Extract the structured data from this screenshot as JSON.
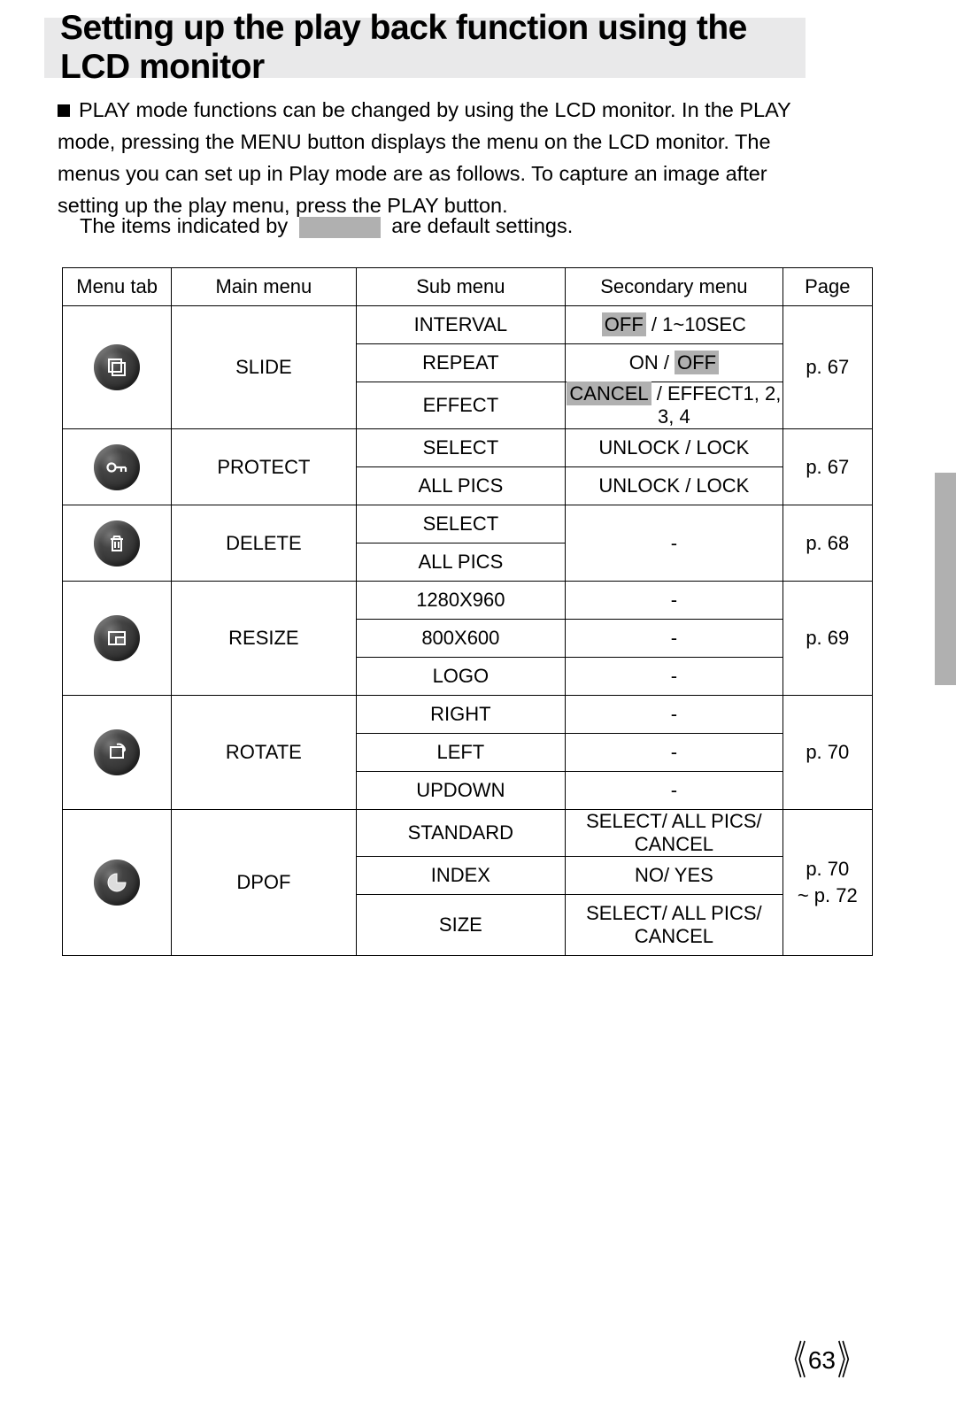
{
  "title": "Setting up the play back function using the LCD monitor",
  "intro": "PLAY mode functions can be changed by using the LCD monitor. In the PLAY mode, pressing the MENU button displays the menu on the LCD monitor. The menus you can set up in Play mode are as follows. To capture an image after setting up the play menu, press the PLAY button.",
  "default_note_pre": "The items indicated by",
  "default_note_post": "are default settings.",
  "headers": {
    "tab": "Menu tab",
    "main": "Main menu",
    "sub": "Sub menu",
    "sec": "Secondary menu",
    "page": "Page"
  },
  "rows": {
    "slide": {
      "main": "SLIDE",
      "page": "p. 67",
      "sub": [
        "INTERVAL",
        "REPEAT",
        "EFFECT"
      ],
      "sec_interval_hl": "OFF",
      "sec_interval_rest": " / 1~10SEC",
      "sec_repeat_pre": "ON / ",
      "sec_repeat_hl": "OFF",
      "sec_effect_hl": "CANCEL",
      "sec_effect_rest": " / EFFECT1, 2, 3, 4"
    },
    "protect": {
      "main": "PROTECT",
      "page": "p. 67",
      "sub": [
        "SELECT",
        "ALL PICS"
      ],
      "sec": [
        "UNLOCK / LOCK",
        "UNLOCK / LOCK"
      ]
    },
    "delete": {
      "main": "DELETE",
      "page": "p. 68",
      "sub": [
        "SELECT",
        "ALL PICS"
      ],
      "sec": "-"
    },
    "resize": {
      "main": "RESIZE",
      "page": "p. 69",
      "sub": [
        "1280X960",
        "800X600",
        "LOGO"
      ],
      "sec": [
        "-",
        "-",
        "-"
      ]
    },
    "rotate": {
      "main": "ROTATE",
      "page": "p. 70",
      "sub": [
        "RIGHT",
        "LEFT",
        "UPDOWN"
      ],
      "sec": [
        "-",
        "-",
        "-"
      ]
    },
    "dpof": {
      "main": "DPOF",
      "page1": "p. 70",
      "page2": "~ p. 72",
      "sub": [
        "STANDARD",
        "INDEX",
        "SIZE"
      ],
      "sec": [
        "SELECT/ ALL PICS/ CANCEL",
        "NO/ YES",
        "SELECT/ ALL PICS/ CANCEL"
      ]
    }
  },
  "pagenum": "63"
}
